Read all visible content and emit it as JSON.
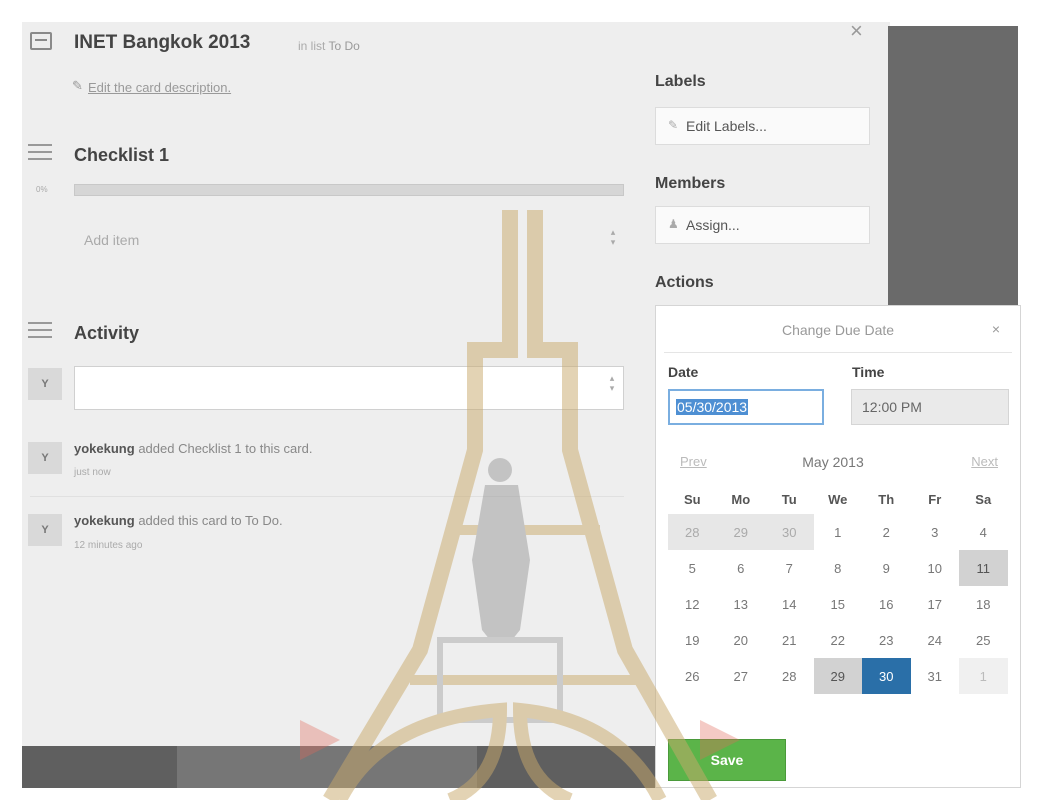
{
  "card": {
    "title": "INET Bangkok 2013",
    "in_list_prefix": "in list",
    "in_list_name": "To Do",
    "close": "×",
    "edit_description": "Edit the card description.",
    "pencil": "✎"
  },
  "checklist": {
    "title": "Checklist 1",
    "percent": "0%",
    "progress_fraction": 0,
    "add_item_placeholder": "Add item"
  },
  "activity": {
    "title": "Activity",
    "avatar_initial": "Y",
    "entries": [
      {
        "user": "yokekung",
        "text": "added Checklist 1 to this card.",
        "time": "just now"
      },
      {
        "user": "yokekung",
        "text": "added this card to To Do.",
        "time": "12 minutes ago"
      }
    ]
  },
  "sidebar": {
    "labels_heading": "Labels",
    "edit_labels": "Edit Labels...",
    "members_heading": "Members",
    "assign": "Assign...",
    "actions_heading": "Actions"
  },
  "due_date_popup": {
    "title": "Change Due Date",
    "close": "×",
    "date_label": "Date",
    "time_label": "Time",
    "date_value": "05/30/2013",
    "time_value": "12:00 PM",
    "prev": "Prev",
    "month": "May 2013",
    "next": "Next",
    "weekdays": [
      "Su",
      "Mo",
      "Tu",
      "We",
      "Th",
      "Fr",
      "Sa"
    ],
    "weeks": [
      [
        "28",
        "29",
        "30",
        "1",
        "2",
        "3",
        "4"
      ],
      [
        "5",
        "6",
        "7",
        "8",
        "9",
        "10",
        "11"
      ],
      [
        "12",
        "13",
        "14",
        "15",
        "16",
        "17",
        "18"
      ],
      [
        "19",
        "20",
        "21",
        "22",
        "23",
        "24",
        "25"
      ],
      [
        "26",
        "27",
        "28",
        "29",
        "30",
        "31",
        "1"
      ]
    ],
    "selected_day": "30",
    "save": "Save"
  },
  "colors": {
    "accent_blue": "#2a6fa8",
    "save_green": "#5bb449",
    "seal_gold": "#c9a96b",
    "seal_red": "#e06a5a"
  }
}
